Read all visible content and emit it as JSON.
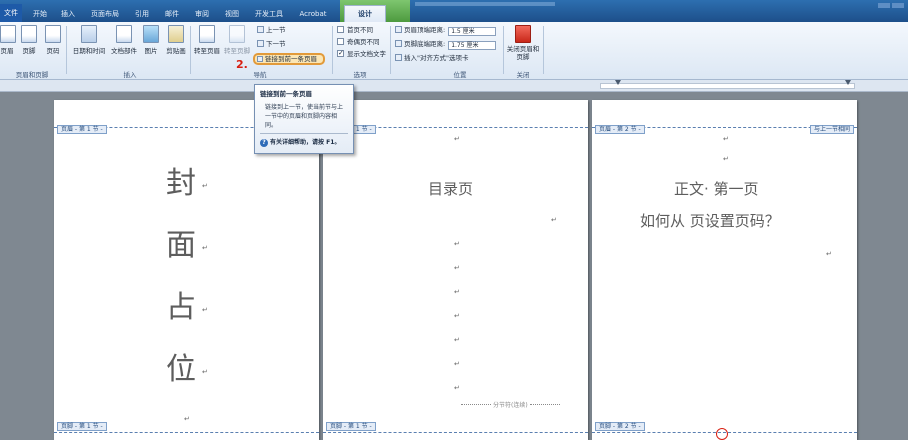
{
  "tabs": {
    "file": "文件",
    "items": [
      "开始",
      "插入",
      "页面布局",
      "引用",
      "邮件",
      "审阅",
      "视图",
      "开发工具",
      "Acrobat"
    ],
    "design": "设计"
  },
  "ribbon": {
    "header_footer_group": {
      "label": "页眉和页脚",
      "header": "页眉",
      "footer": "页脚",
      "page_number": "页码"
    },
    "insert_group": {
      "label": "插入",
      "datetime": "日期和时间",
      "quickparts": "文档部件",
      "picture": "图片",
      "clipart": "剪贴画"
    },
    "nav_group": {
      "label": "导航",
      "goto_header": "转至页眉",
      "goto_footer": "转至页脚",
      "prev": "上一节",
      "next": "下一节",
      "link_previous": "链接到前一条页眉"
    },
    "options_group": {
      "label": "选项",
      "diff_first": "首页不同",
      "diff_odd_even": "奇偶页不同",
      "show_text": "显示文档文字"
    },
    "position_group": {
      "label": "位置",
      "header_top_label": "页眉顶端距离:",
      "header_top_value": "1.5 厘米",
      "footer_bottom_label": "页脚底端距离:",
      "footer_bottom_value": "1.75 厘米",
      "insert_align_tab": "插入\"对齐方式\"选项卡"
    },
    "close_group": {
      "label": "关闭",
      "close_btn": "关闭页眉和页脚"
    }
  },
  "step_number": "2.",
  "tooltip": {
    "title": "链接到前一条页眉",
    "body": "链接到上一节，使当前节与上一节中的页眉和页脚内容相同。",
    "help": "有关详细帮助，请按 F1。"
  },
  "pages": [
    {
      "header_tag": "页眉 - 第 1 节 -",
      "footer_tag": "页脚 - 第 1 节 -",
      "chars": [
        "封",
        "面",
        "占",
        "位"
      ]
    },
    {
      "header_tag": "页眉 - 第 1 节 -",
      "footer_tag": "页脚 - 第 1 节 -",
      "title": "目录页",
      "section_break": "分节符(连续)"
    },
    {
      "header_tag": "页眉 - 第 2 节 -",
      "header_right_tag": "与上一节相同",
      "footer_tag": "页脚 - 第 2 节 -",
      "line1": "正文· 第一页",
      "line2": "如何从 页设置页码？"
    }
  ],
  "paragraph_mark": "↵"
}
